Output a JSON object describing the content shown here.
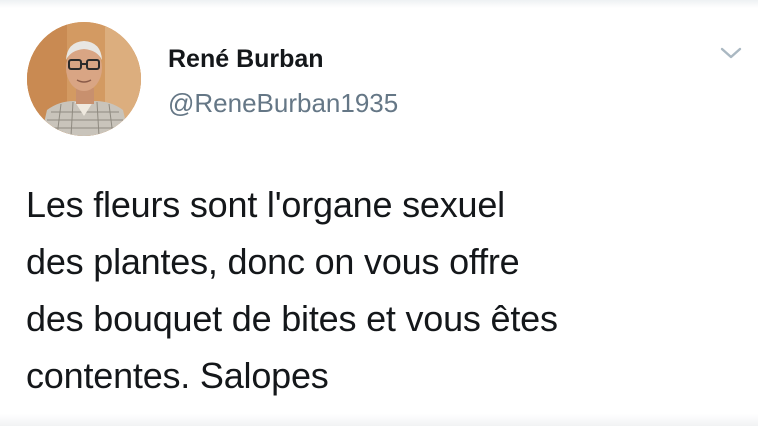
{
  "tweet": {
    "author": {
      "display_name": "René Burban",
      "handle": "@ReneBurban1935",
      "avatar_icon": "avatar-photo"
    },
    "menu_icon": "chevron-down-icon",
    "text": "Les fleurs sont l'organe sexuel\ndes plantes, donc on vous offre\ndes bouquet de bites et vous êtes\ncontentes. Salopes"
  },
  "colors": {
    "text_primary": "#14171a",
    "text_secondary": "#657786",
    "caret": "#aab8c2",
    "background": "#ffffff"
  }
}
